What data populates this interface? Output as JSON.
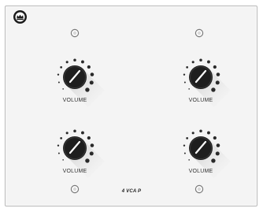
{
  "panel": {
    "model_label": "4 VCA P",
    "logo_icon": "crown-logo-icon",
    "colors": {
      "plate": "#f4f4f4",
      "knob": "#1e1e1e",
      "dots": "#2a2a2a",
      "text": "#333333"
    }
  },
  "knobs": [
    {
      "label": "VOLUME"
    },
    {
      "label": "VOLUME"
    },
    {
      "label": "VOLUME"
    },
    {
      "label": "VOLUME"
    }
  ],
  "screws": [
    "screw",
    "screw",
    "screw",
    "screw"
  ]
}
